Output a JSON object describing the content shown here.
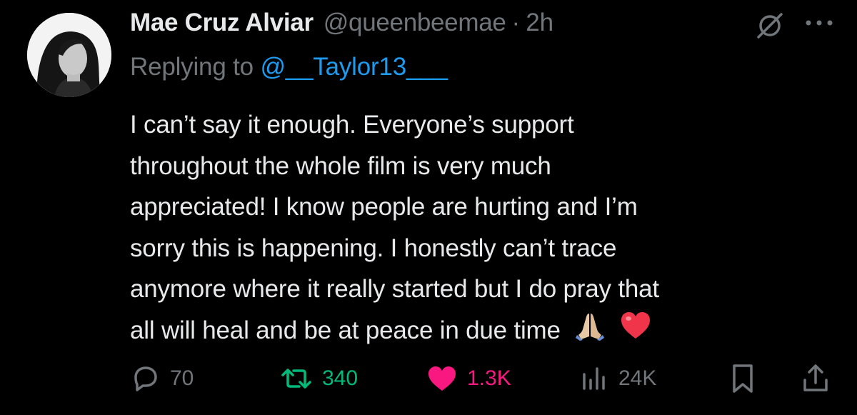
{
  "author": {
    "name": "Mae Cruz Alviar",
    "handle": "@queenbeemae",
    "separator": "·",
    "time": "2h"
  },
  "reply": {
    "prefix": "Replying to ",
    "mention": "@__Taylor13___"
  },
  "tweet_lines": [
    "I can’t say it enough. Everyone’s support",
    "throughout the whole film is very much",
    "appreciated! I know people are hurting and I’m",
    "sorry this is happening. I honestly can’t trace",
    "anymore where it really started but I do pray that",
    "all will heal and be at peace in due time"
  ],
  "emojis": [
    "folded-hands-emoji",
    "red-heart-emoji"
  ],
  "actions": {
    "replies": "70",
    "reposts": "340",
    "likes": "1.3K",
    "views": "24K"
  },
  "colors": {
    "background": "#000000",
    "text": "#e7e9ea",
    "muted": "#71767b",
    "link": "#1d9bf0",
    "repost": "#00ba7c",
    "like": "#f91880"
  }
}
